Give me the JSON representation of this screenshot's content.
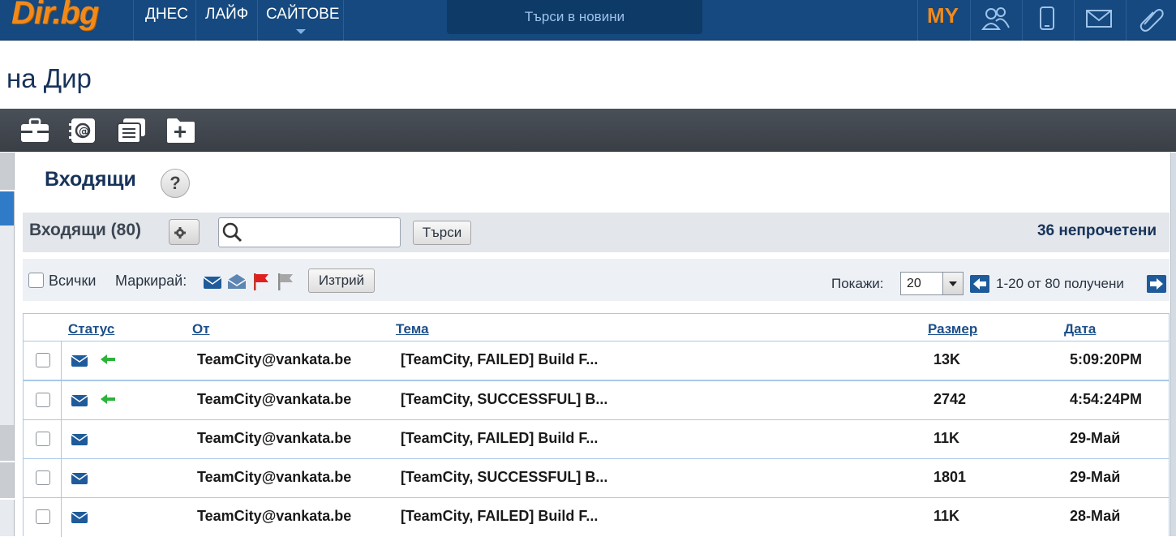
{
  "brand": {
    "logo_text": "Dir.bg",
    "accent": "#f28a1a",
    "bar_color": "#15497f"
  },
  "topnav": {
    "items": [
      {
        "label": "ДНЕС"
      },
      {
        "label": "ЛАЙФ"
      },
      {
        "label": "САЙТОВЕ"
      }
    ],
    "search_placeholder": "Търси в новини",
    "my_label": "MY",
    "icons": [
      "people-icon",
      "mobile-icon",
      "mail-icon",
      "paperclip-icon"
    ]
  },
  "page": {
    "heading": "на Дир"
  },
  "toolbar": {
    "icons": [
      "briefcase-icon",
      "address-book-icon",
      "notes-icon",
      "folder-add-icon"
    ]
  },
  "mailbox": {
    "title": "Входящи",
    "help": "?",
    "folder_label": "Входящи (80)",
    "search_button": "Търси",
    "unread": "36 непрочетени",
    "select_all_label": "Всички",
    "mark_label": "Маркирай:",
    "mark_icons": [
      "mark-unread-icon",
      "mark-read-icon",
      "flag-red-icon",
      "flag-gray-icon"
    ],
    "delete_button": "Изтрий",
    "show_label": "Покажи:",
    "page_size": "20",
    "range": "1-20 от 80 получени"
  },
  "table": {
    "columns": {
      "status": "Статус",
      "from": "От",
      "subject": "Тема",
      "size": "Размер",
      "date": "Дата"
    },
    "rows": [
      {
        "replied": true,
        "from": "TeamCity@vankata.be",
        "subject": "[TeamCity, FAILED] Build F...",
        "size": "13K",
        "date": "5:09:20PM"
      },
      {
        "replied": true,
        "from": "TeamCity@vankata.be",
        "subject": "[TeamCity, SUCCESSFUL] B...",
        "size": "2742",
        "date": "4:54:24PM"
      },
      {
        "replied": false,
        "from": "TeamCity@vankata.be",
        "subject": "[TeamCity, FAILED] Build F...",
        "size": "11K",
        "date": "29-Май"
      },
      {
        "replied": false,
        "from": "TeamCity@vankata.be",
        "subject": "[TeamCity, SUCCESSFUL] B...",
        "size": "1801",
        "date": "29-Май"
      },
      {
        "replied": false,
        "from": "TeamCity@vankata.be",
        "subject": "[TeamCity, FAILED] Build F...",
        "size": "11K",
        "date": "28-Май"
      }
    ]
  }
}
